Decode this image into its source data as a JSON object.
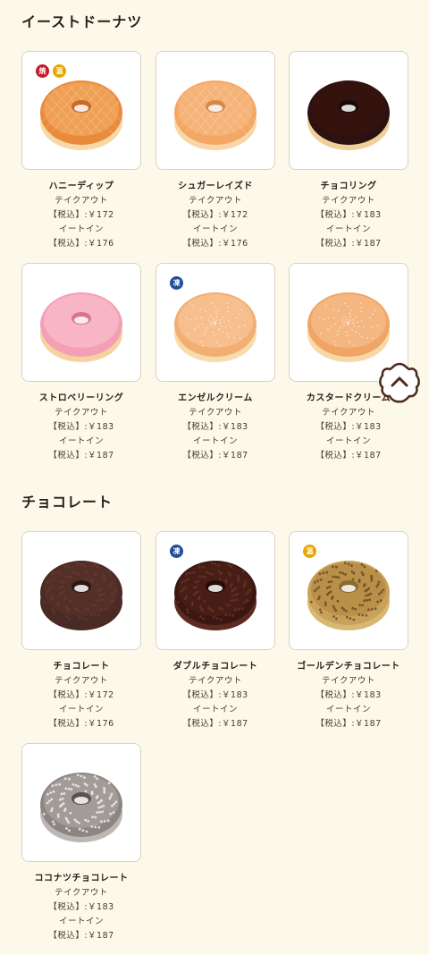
{
  "sections": [
    {
      "title": "イーストドーナツ",
      "items": [
        {
          "name": "ハニーディップ",
          "takeout_label": "テイクアウト",
          "takeout_price": "【税込】:￥172",
          "eatin_label": "イートイン",
          "eatin_price": "【税込】:￥176",
          "badges": [
            {
              "text": "焼",
              "color": "#c8182a"
            },
            {
              "text": "温",
              "color": "#e6a800"
            }
          ]
        },
        {
          "name": "シュガーレイズド",
          "takeout_label": "テイクアウト",
          "takeout_price": "【税込】:￥172",
          "eatin_label": "イートイン",
          "eatin_price": "【税込】:￥176",
          "badges": []
        },
        {
          "name": "チョコリング",
          "takeout_label": "テイクアウト",
          "takeout_price": "【税込】:￥183",
          "eatin_label": "イートイン",
          "eatin_price": "【税込】:￥187",
          "badges": []
        },
        {
          "name": "ストロベリーリング",
          "takeout_label": "テイクアウト",
          "takeout_price": "【税込】:￥183",
          "eatin_label": "イートイン",
          "eatin_price": "【税込】:￥187",
          "badges": []
        },
        {
          "name": "エンゼルクリーム",
          "takeout_label": "テイクアウト",
          "takeout_price": "【税込】:￥183",
          "eatin_label": "イートイン",
          "eatin_price": "【税込】:￥187",
          "badges": [
            {
              "text": "凍",
              "color": "#1f4f9a"
            }
          ]
        },
        {
          "name": "カスタードクリーム",
          "takeout_label": "テイクアウト",
          "takeout_price": "【税込】:￥183",
          "eatin_label": "イートイン",
          "eatin_price": "【税込】:￥187",
          "badges": []
        }
      ]
    },
    {
      "title": "チョコレート",
      "items": [
        {
          "name": "チョコレート",
          "takeout_label": "テイクアウト",
          "takeout_price": "【税込】:￥172",
          "eatin_label": "イートイン",
          "eatin_price": "【税込】:￥176",
          "badges": []
        },
        {
          "name": "ダブルチョコレート",
          "takeout_label": "テイクアウト",
          "takeout_price": "【税込】:￥183",
          "eatin_label": "イートイン",
          "eatin_price": "【税込】:￥187",
          "badges": [
            {
              "text": "凍",
              "color": "#1f4f9a"
            }
          ]
        },
        {
          "name": "ゴールデンチョコレート",
          "takeout_label": "テイクアウト",
          "takeout_price": "【税込】:￥183",
          "eatin_label": "イートイン",
          "eatin_price": "【税込】:￥187",
          "badges": [
            {
              "text": "温",
              "color": "#e6a800"
            }
          ]
        },
        {
          "name": "ココナツチョコレート",
          "takeout_label": "テイクアウト",
          "takeout_price": "【税込】:￥183",
          "eatin_label": "イートイン",
          "eatin_price": "【税込】:￥187",
          "badges": []
        }
      ]
    }
  ],
  "scroll_top_icon": "chevron-up-icon"
}
